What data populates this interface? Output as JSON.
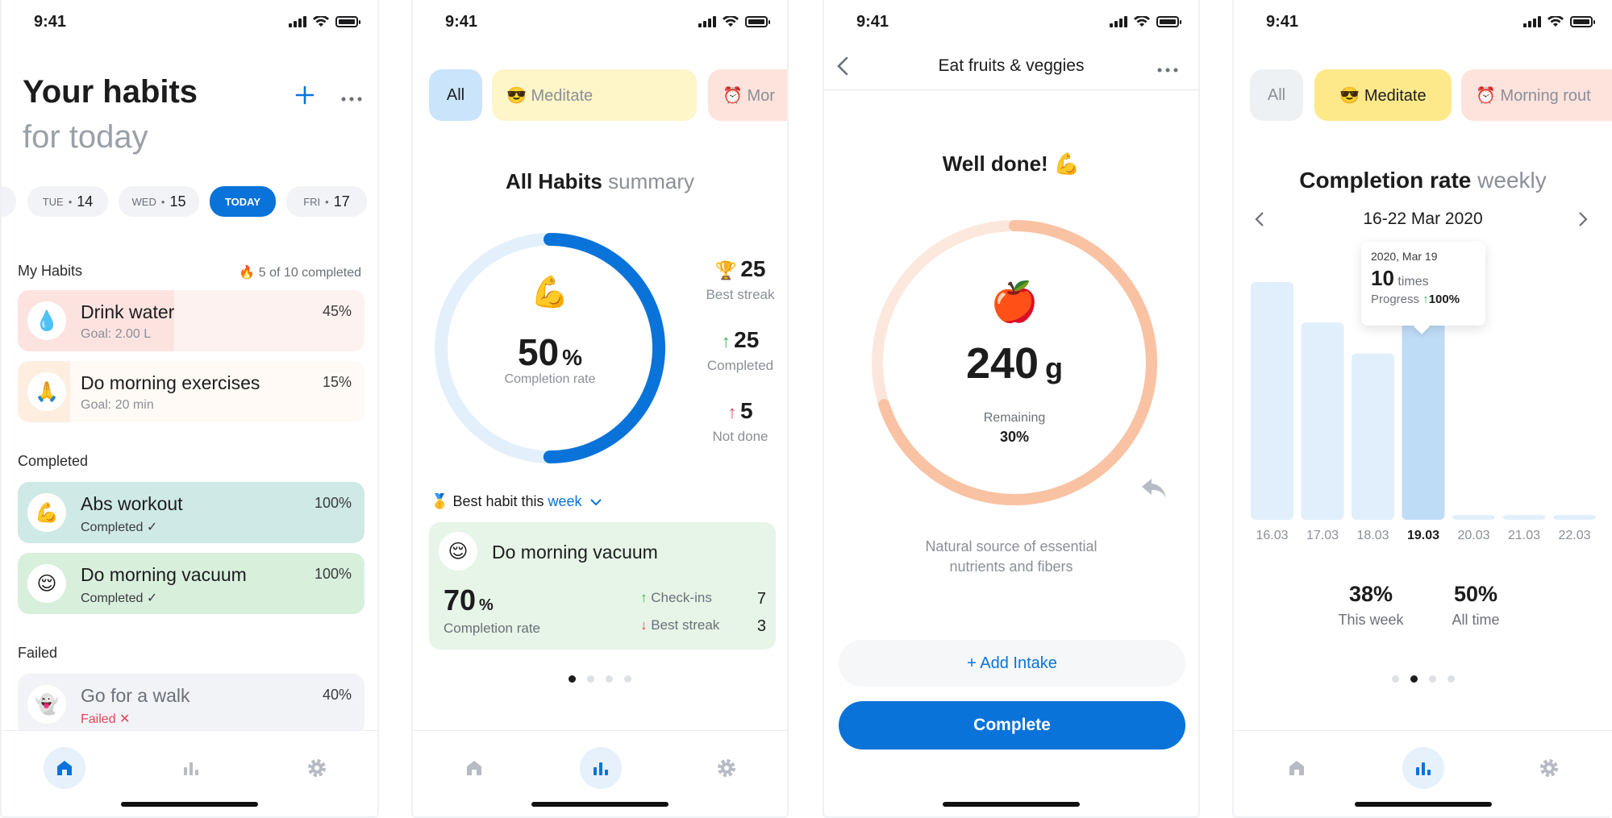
{
  "status": {
    "time": "9:41"
  },
  "screen1": {
    "title": "Your habits",
    "subtitle": "for today",
    "days": [
      {
        "name": "TUE",
        "num": "14"
      },
      {
        "name": "WED",
        "num": "15"
      },
      {
        "name": "TODAY",
        "num": ""
      },
      {
        "name": "FRI",
        "num": "17"
      }
    ],
    "my_habits_label": "My Habits",
    "completed_count": "5 of 10 completed",
    "habits": [
      {
        "icon": "💧",
        "name": "Drink water",
        "sub": "Goal: 2.00 L",
        "pct": "45%",
        "progress": 0.45,
        "color": "#fde3e0"
      },
      {
        "icon": "🙏",
        "name": "Do morning exercises",
        "sub": "Goal: 20 min",
        "pct": "15%",
        "progress": 0.15,
        "color": "#fdeee0"
      }
    ],
    "completed_label": "Completed",
    "completed": [
      {
        "icon": "💪",
        "name": "Abs workout",
        "sub": "Completed ✓",
        "pct": "100%",
        "color": "#cfe9e6"
      },
      {
        "icon": "😌",
        "name": "Do morning vacuum",
        "sub": "Completed ✓",
        "pct": "100%",
        "color": "#d8efdc"
      }
    ],
    "failed_label": "Failed",
    "failed": [
      {
        "icon": "👻",
        "name": "Go for a walk",
        "sub": "Failed ✕",
        "pct": "40%",
        "color": "#f1f3f6"
      }
    ]
  },
  "screen2": {
    "filters": [
      "All",
      "😎  Meditate",
      "⏰  Mor"
    ],
    "title_bold": "All Habits",
    "title_light": "summary",
    "ring_icon": "💪",
    "ring_value": "50",
    "ring_unit": "%",
    "ring_label": "Completion rate",
    "ring_progress": 0.5,
    "stats": [
      {
        "icon": "🏆",
        "value": "25",
        "label": "Best streak"
      },
      {
        "icon": "↑",
        "value": "25",
        "label": "Completed"
      },
      {
        "icon": "↑",
        "value": "5",
        "label": "Not done"
      }
    ],
    "best_habit_prefix": "Best habit this",
    "best_habit_period": "week",
    "best_card": {
      "icon": "😌",
      "name": "Do morning vacuum",
      "rate": "70",
      "rate_unit": "%",
      "rate_label": "Completion rate",
      "checkins_label": "Check-ins",
      "checkins": "7",
      "streak_label": "Best streak",
      "streak": "3"
    }
  },
  "screen3": {
    "title": "Eat fruits & veggies",
    "well_done": "Well done! 💪",
    "icon": "🍎",
    "value": "240",
    "unit": "g",
    "remaining_label": "Remaining",
    "remaining_pct": "30%",
    "ring_progress": 0.7,
    "description_l1": "Natural source of essential",
    "description_l2": "nutrients and fibers",
    "add_intake": "+  Add Intake",
    "complete": "Complete"
  },
  "screen4": {
    "filters": [
      "All",
      "😎  Meditate",
      "⏰  Morning rout"
    ],
    "title_bold": "Completion rate",
    "title_light": "weekly",
    "range": "16-22 Mar 2020",
    "tooltip": {
      "date": "2020, Mar 19",
      "count": "10",
      "unit": "times",
      "progress_label": "Progress",
      "progress": "100%"
    },
    "summary": [
      {
        "value": "38%",
        "label": "This week"
      },
      {
        "value": "50%",
        "label": "All time"
      }
    ]
  },
  "chart_data": {
    "type": "bar",
    "categories": [
      "16.03",
      "17.03",
      "18.03",
      "19.03",
      "20.03",
      "21.03",
      "22.03"
    ],
    "values": [
      100,
      83,
      70,
      100,
      2,
      2,
      2
    ],
    "highlight": "19.03",
    "title": "Completion rate weekly",
    "ylim": [
      0,
      100
    ]
  },
  "colors": {
    "accent": "#0a73d9",
    "ring_bg": "#e3f0fc",
    "peach": "#f9c2a3"
  }
}
